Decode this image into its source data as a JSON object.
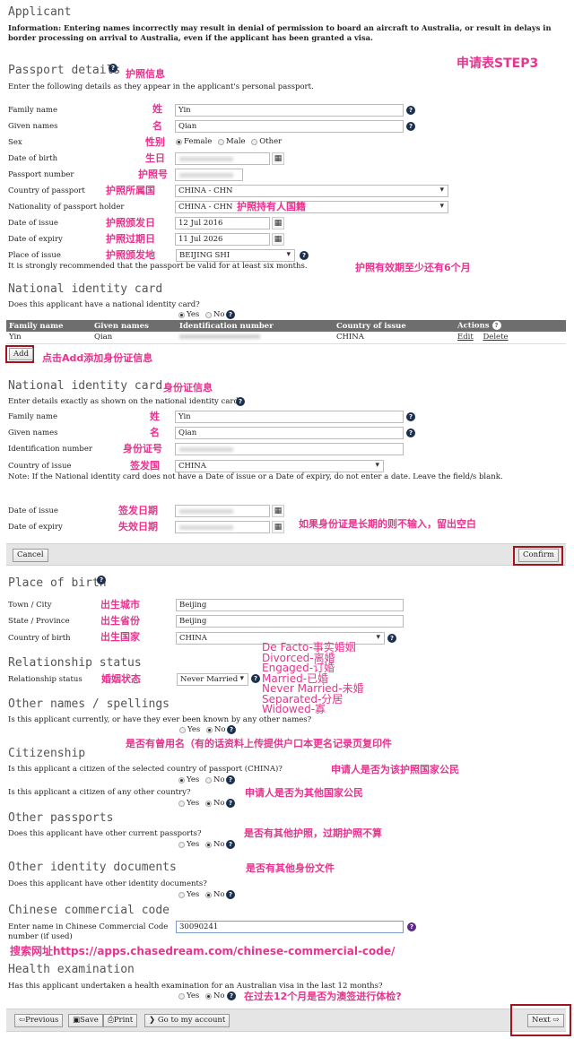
{
  "applicant": {
    "title": "Applicant",
    "info": "Information: Entering names incorrectly may result in denial of permission to board an aircraft to Australia, or result in delays in border processing on arrival to Australia, even if the applicant has been granted a visa."
  },
  "annotation_step": "申请表STEP3",
  "passport": {
    "title": "Passport details",
    "title_note": "护照信息",
    "intro": "Enter the following details as they appear in the applicant's personal passport.",
    "family_name": {
      "label": "Family name",
      "note": "姓",
      "value": "Yin"
    },
    "given_names": {
      "label": "Given names",
      "note": "名",
      "value": "Qian"
    },
    "sex": {
      "label": "Sex",
      "note": "性别",
      "options": [
        "Female",
        "Male",
        "Other"
      ],
      "selected": "Female"
    },
    "dob": {
      "label": "Date of birth",
      "note": "生日",
      "value": "[blurred]"
    },
    "number": {
      "label": "Passport number",
      "note": "护照号",
      "value": "[blurred]"
    },
    "country": {
      "label": "Country of passport",
      "note": "护照所属国",
      "value": "CHINA - CHN"
    },
    "nationality": {
      "label": "Nationality of passport holder",
      "note": "护照持有人国籍",
      "value": "CHINA - CHN"
    },
    "issue_date": {
      "label": "Date of issue",
      "note": "护照颁发日",
      "value": "12 Jul 2016"
    },
    "expiry_date": {
      "label": "Date of expiry",
      "note": "护照过期日",
      "value": "11 Jul 2026"
    },
    "place_issue": {
      "label": "Place of issue",
      "note": "护照颁发地",
      "value": "BEIJING SHI"
    },
    "validity_note": "It is strongly recommended that the passport be valid for at least six months.",
    "validity_annotation": "护照有效期至少还有6个月"
  },
  "nic": {
    "title": "National identity card",
    "question": "Does this applicant have a national identity card?",
    "yes": "Yes",
    "no": "No",
    "selected": "Yes",
    "table": {
      "headers": [
        "Family name",
        "Given names",
        "Identification number",
        "Country of issue",
        "Actions"
      ],
      "rows": [
        {
          "family": "Yin",
          "given": "Qian",
          "id": "[blurred]",
          "country": "CHINA",
          "edit": "Edit",
          "delete": "Delete"
        }
      ]
    },
    "add_label": "Add",
    "add_annotation": "点击Add添加身份证信息"
  },
  "nic_form": {
    "title": "National identity card",
    "title_note": "身份证信息",
    "intro": "Enter details exactly as shown on the national identity card.",
    "family_name": {
      "label": "Family name",
      "note": "姓",
      "value": "Yin"
    },
    "given_names": {
      "label": "Given names",
      "note": "名",
      "value": "Qian"
    },
    "id_number": {
      "label": "Identification number",
      "note": "身份证号",
      "value": "[blurred]"
    },
    "country": {
      "label": "Country of issue",
      "note": "签发国",
      "value": "CHINA"
    },
    "note": "Note: If the National identity card does not have a Date of issue or a Date of expiry, do not enter a date. Leave the field/s blank.",
    "issue_date": {
      "label": "Date of issue",
      "note": "签发日期",
      "value": "[blurred]"
    },
    "expiry_date": {
      "label": "Date of expiry",
      "note": "失效日期",
      "value": "[blurred]"
    },
    "date_annotation": "如果身份证是长期的则不输入，留出空白",
    "cancel_label": "Cancel",
    "confirm_label": "Confirm"
  },
  "birth": {
    "title": "Place of birth",
    "town": {
      "label": "Town / City",
      "note": "出生城市",
      "value": "Beijing"
    },
    "state": {
      "label": "State / Province",
      "note": "出生省份",
      "value": "Beijing"
    },
    "country": {
      "label": "Country of birth",
      "note": "出生国家",
      "value": "CHINA"
    }
  },
  "relationship": {
    "title": "Relationship status",
    "label": "Relationship status",
    "note": "婚姻状态",
    "value": "Never Married",
    "options_annotation": [
      "De Facto-事实婚姻",
      "Divorced-离婚",
      "Engaged-订婚",
      "Married-已婚",
      "Never Married-未婚",
      "Separated-分居",
      "Widowed-寡"
    ]
  },
  "other_names": {
    "title": "Other names / spellings",
    "question": "Is this applicant currently, or have they ever been known by any other names?",
    "yes": "Yes",
    "no": "No",
    "selected": "No",
    "annotation": "是否有曾用名（有的话资料上传提供户口本更名记录页复印件"
  },
  "citizenship": {
    "title": "Citizenship",
    "q1": "Is this applicant a citizen of the selected country of passport (CHINA)?",
    "q1_annotation": "申请人是否为该护照国家公民",
    "q1_selected": "Yes",
    "q2": "Is this applicant a citizen of any other country?",
    "q2_annotation": "申请人是否为其他国家公民",
    "q2_selected": "No",
    "yes": "Yes",
    "no": "No"
  },
  "other_passports": {
    "title": "Other passports",
    "question": "Does this applicant have other current passports?",
    "annotation": "是否有其他护照，过期护照不算",
    "yes": "Yes",
    "no": "No",
    "selected": "No"
  },
  "other_ids": {
    "title": "Other identity documents",
    "title_annotation": "是否有其他身份文件",
    "question": "Does this applicant have other identity documents?",
    "yes": "Yes",
    "no": "No",
    "selected": "No"
  },
  "ccc": {
    "title": "Chinese commercial code",
    "label": "Enter name in Chinese Commercial Code number (if used)",
    "value": "30090241",
    "annotation": "搜索网址https://apps.chasedream.com/chinese-commercial-code/"
  },
  "health": {
    "title": "Health examination",
    "question": "Has this applicant undertaken a health examination for an Australian visa in the last 12 months?",
    "yes": "Yes",
    "no": "No",
    "selected": "No",
    "annotation": "在过去12个月是否为澳签进行体检?"
  },
  "footer": {
    "previous": "Previous",
    "save": "Save",
    "print": "Print",
    "account": "Go to my account",
    "next": "Next"
  },
  "colors": {
    "annotation": "#e8348e",
    "highlight_box": "#a3141f",
    "table_header": "#6e6e6e",
    "help_icon": "#1b2f4f"
  }
}
